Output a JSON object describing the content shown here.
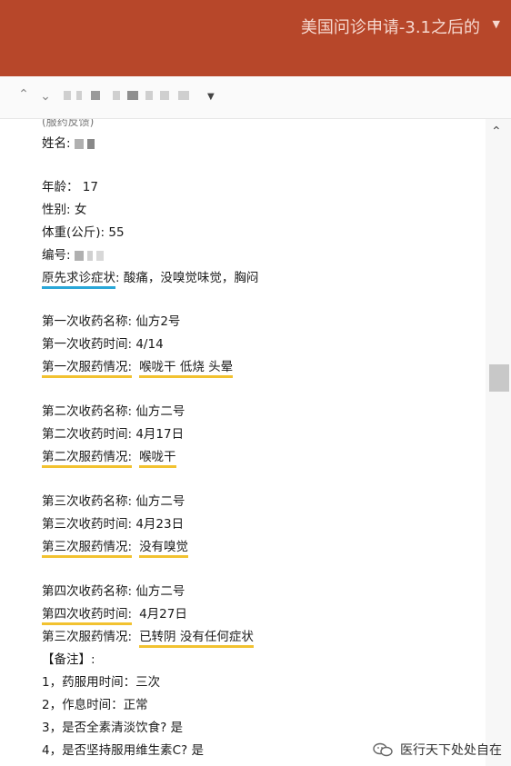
{
  "window": {
    "title": "美国问诊申请-3.1之后的",
    "accent": "#b7472a"
  },
  "content": {
    "cut_line": "(服药反馈)",
    "name_label": "姓名:",
    "age": "年龄： 17",
    "gender": "性别: 女",
    "weight": "体重(公斤): 55",
    "id_label": "编号:",
    "symptoms_label": "原先求诊症状",
    "symptoms_value": ": 酸痛，没嗅觉味觉，胸闷",
    "first": {
      "med": "第一次收药名称: 仙方2号",
      "time": "第一次收药时间: 4/14",
      "status_label": "第一次服药情况:",
      "status_value": "喉咙干 低烧 头晕"
    },
    "second": {
      "med": "第二次收药名称: 仙方二号",
      "time": "第二次收药时间: 4月17日",
      "status_label": "第二次服药情况:",
      "status_value": "喉咙干"
    },
    "third": {
      "med": "第三次收药名称: 仙方二号",
      "time": "第三次收药时间: 4月23日",
      "status_label": "第三次服药情况:",
      "status_value": "没有嗅觉"
    },
    "fourth": {
      "med": "第四次收药名称: 仙方二号",
      "time_label": "第四次收药时间:",
      "time_value": "4月27日",
      "status_label": "第三次服药情况:",
      "status_value": "已转阴 没有任何症状"
    },
    "notes_header": "【备注】:",
    "notes": [
      "1，药服用时间：三次",
      "2，作息时间：正常",
      "3，是否全素清淡饮食? 是",
      "4，是否坚持服用维生素C? 是"
    ]
  },
  "watermark": {
    "text": "医行天下处处自在"
  }
}
